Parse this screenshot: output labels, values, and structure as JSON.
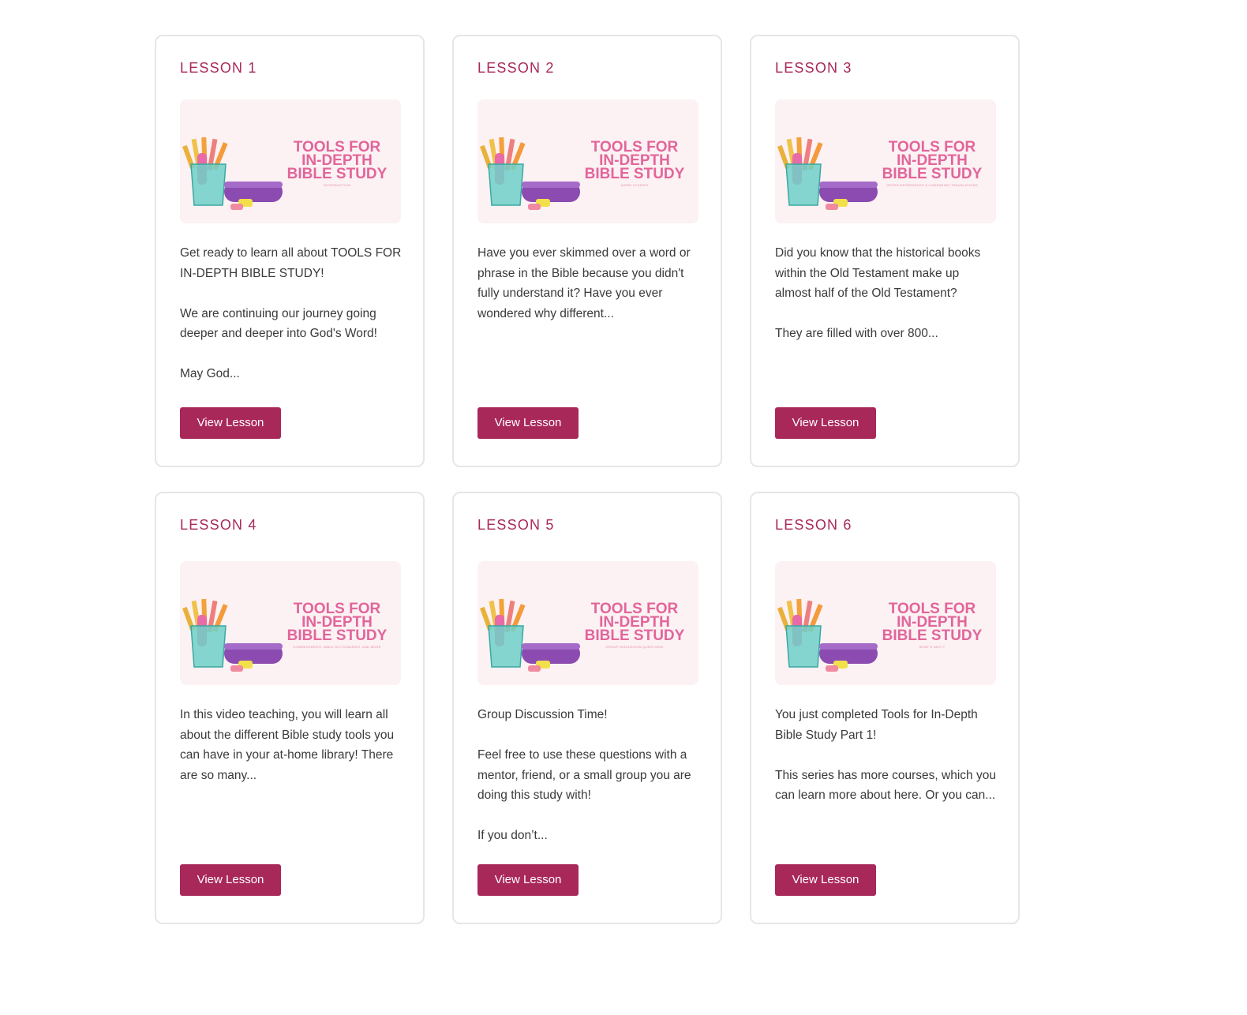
{
  "colors": {
    "accent": "#a8285a",
    "thumb_bg": "#fcf1f3",
    "thumb_title": "#e2659a",
    "card_border": "#e6e6e6"
  },
  "lessons": [
    {
      "title": "LESSON 1",
      "thumb_title": "TOOLS FOR IN-DEPTH BIBLE STUDY",
      "thumb_sub": "INTRODUCTION",
      "description": "Get ready to learn all about TOOLS FOR IN-DEPTH BIBLE STUDY!\n\nWe are continuing our journey going deeper and deeper into God's Word!\n\nMay God...",
      "button": "View Lesson"
    },
    {
      "title": "LESSON 2",
      "thumb_title": "TOOLS FOR IN-DEPTH BIBLE STUDY",
      "thumb_sub": "WORD STUDIES",
      "description": "Have you ever skimmed over a word or phrase in the Bible because you didn't fully understand it? Have you ever wondered why different...",
      "button": "View Lesson"
    },
    {
      "title": "LESSON 3",
      "thumb_title": "TOOLS FOR IN-DEPTH BIBLE STUDY",
      "thumb_sub": "CROSS-REFERENCES & COMPARING TRANSLATIONS",
      "description": "Did you know that the historical books within the Old Testament make up almost half of the Old Testament?\n\nThey are filled with over 800...",
      "button": "View Lesson"
    },
    {
      "title": "LESSON 4",
      "thumb_title": "TOOLS FOR IN-DEPTH BIBLE STUDY",
      "thumb_sub": "COMMENTARIES, BIBLE DICTIONARIES, AND MORE",
      "description": "In this video teaching, you will learn all about the different Bible study tools you can have in your at-home library! There are so many...",
      "button": "View Lesson"
    },
    {
      "title": "LESSON 5",
      "thumb_title": "TOOLS FOR IN-DEPTH BIBLE STUDY",
      "thumb_sub": "GROUP DISCUSSION QUESTIONS",
      "description": "Group Discussion Time!\n\nFeel free to use these questions with a mentor, friend, or a small group you are doing this study with!\n\nIf you don’t...",
      "button": "View Lesson"
    },
    {
      "title": "LESSON 6",
      "thumb_title": "TOOLS FOR IN-DEPTH BIBLE STUDY",
      "thumb_sub": "WHAT'S NEXT?",
      "description": "You just completed Tools for In-Depth Bible Study Part 1!\n\nThis series has more courses, which you can learn more about here. Or you can...",
      "button": "View Lesson"
    }
  ]
}
